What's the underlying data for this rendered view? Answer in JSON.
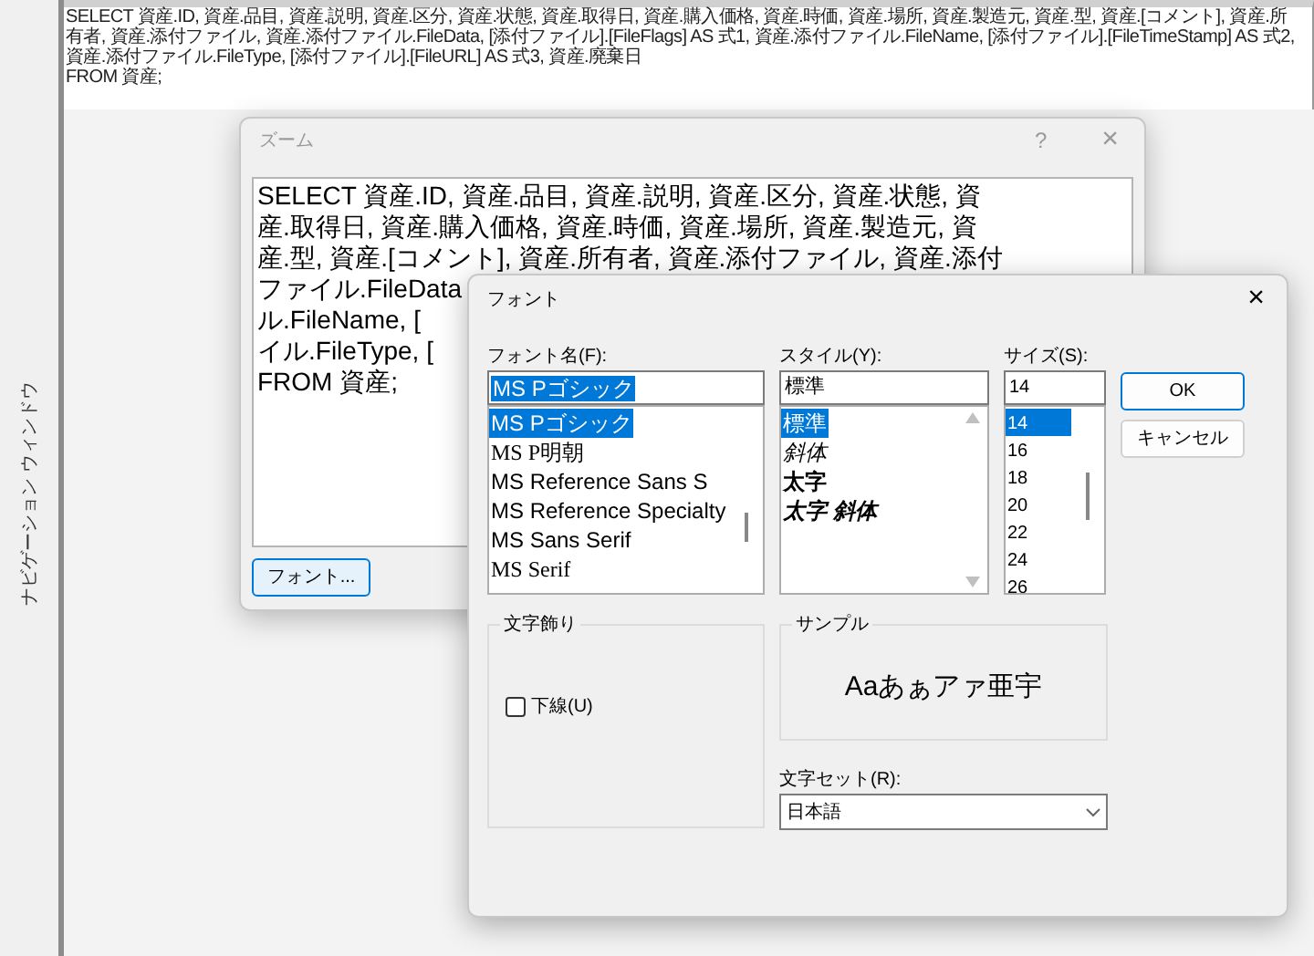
{
  "navigation_pane": {
    "label": "ナビゲーション ウィンドウ"
  },
  "sql_view": {
    "text": "SELECT 資産.ID, 資産.品目, 資産.説明, 資産.区分, 資産.状態, 資産.取得日, 資産.購入価格, 資産.時価, 資産.場所, 資産.製造元, 資産.型, 資産.[コメント], 資産.所有者, 資産.添付ファイル, 資産.添付ファイル.FileData, [添付ファイル].[FileFlags] AS 式1, 資産.添付ファイル.FileName, [添付ファイル].[FileTimeStamp] AS 式2, 資産.添付ファイル.FileType, [添付ファイル].[FileURL] AS 式3, 資産.廃棄日\nFROM 資産;"
  },
  "zoom_dialog": {
    "title": "ズーム",
    "help": "?",
    "close": "×",
    "text_lines": [
      "SELECT 資産.ID, 資産.品目, 資産.説明, 資産.区分, 資産.状態, 資",
      "産.取得日, 資産.購入価格, 資産.時価, 資産.場所, 資産.製造元, 資",
      "産.型, 資産.[コメント], 資産.所有者, 資産.添付ファイル, 資産.添付",
      "ファイル.FileData",
      "ル.FileName, [",
      "イル.FileType, [",
      "FROM 資産;"
    ],
    "font_button": "フォント..."
  },
  "font_dialog": {
    "title": "フォント",
    "close": "×",
    "font_name": {
      "label": "フォント名(F):",
      "value": "MS Pゴシック",
      "items": [
        {
          "label": "MS Pゴシック",
          "kind": "sans",
          "selected": true
        },
        {
          "label": "MS P明朝",
          "kind": "serif",
          "selected": false
        },
        {
          "label": "MS Reference Sans S",
          "kind": "sans",
          "selected": false
        },
        {
          "label": "MS Reference Specialty",
          "kind": "sans",
          "selected": false
        },
        {
          "label": "MS Sans Serif",
          "kind": "sans",
          "selected": false
        },
        {
          "label": "MS Serif",
          "kind": "serif",
          "selected": false
        }
      ]
    },
    "style": {
      "label": "スタイル(Y):",
      "value": "標準",
      "items": [
        {
          "label": "標準",
          "kind": "regular",
          "selected": true
        },
        {
          "label": "斜体",
          "kind": "italic",
          "selected": false
        },
        {
          "label": "太字",
          "kind": "bold",
          "selected": false
        },
        {
          "label": "太字 斜体",
          "kind": "bold-italic",
          "selected": false
        }
      ]
    },
    "size": {
      "label": "サイズ(S):",
      "value": "14",
      "items": [
        {
          "label": "14",
          "selected": true
        },
        {
          "label": "16",
          "selected": false
        },
        {
          "label": "18",
          "selected": false
        },
        {
          "label": "20",
          "selected": false
        },
        {
          "label": "22",
          "selected": false
        },
        {
          "label": "24",
          "selected": false
        },
        {
          "label": "26",
          "selected": false
        }
      ]
    },
    "buttons": [
      "OK",
      "キャンセル"
    ],
    "effects": {
      "title": "文字飾り",
      "underline": {
        "label": "下線(U)",
        "checked": false
      }
    },
    "sample": {
      "title": "サンプル",
      "text": "Aaあぁアァ亜宇"
    },
    "charset": {
      "label": "文字セット(R):",
      "value": "日本語"
    }
  }
}
